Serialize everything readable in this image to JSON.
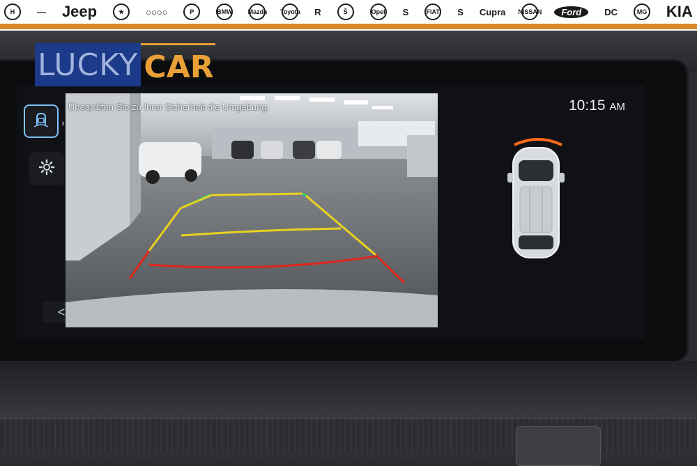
{
  "brands": {
    "items": [
      "H",
      "—",
      "Jeep",
      "★",
      "○○○○",
      "P",
      "BMW",
      "Mazda",
      "Toyota",
      "R",
      "Š",
      "Opel",
      "S",
      "FIAT",
      "S",
      "Cupra",
      "NISSAN",
      "Ford",
      "DC",
      "MG",
      "KIA"
    ]
  },
  "logo": {
    "part1": "LUCKY",
    "part2": "CAR"
  },
  "camera": {
    "message": "Überprüfen Sie zu Ihrer Sicherheit die Umgebung."
  },
  "status": {
    "time": "10:15",
    "ampm": "AM"
  },
  "nav": {
    "back_glyph": "<",
    "expand_glyph": "›"
  },
  "colors": {
    "accent": "#7fc3ff",
    "guide_green": "#2bd66b",
    "guide_yellow": "#e8d21f",
    "guide_red": "#e0261b",
    "sensor_orange": "#ff6a1a",
    "logo_blue": "#1c3a8a",
    "logo_orange": "#e9a037"
  },
  "icons": {
    "parking_assist": "parking-camera-icon",
    "settings": "gear-icon",
    "back": "chevron-left-icon"
  }
}
